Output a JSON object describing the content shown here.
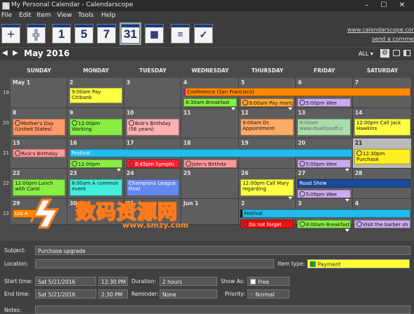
{
  "window": {
    "title": "My Personal Calendar - Calendarscope"
  },
  "menu": [
    "File",
    "Edit",
    "Item",
    "View",
    "Tools",
    "Help"
  ],
  "toolbar": {
    "buttons": [
      "",
      "",
      "1",
      "5",
      "7",
      "31",
      "",
      "",
      ""
    ],
    "site_link": "www.calendarscope.com",
    "comment_link": "send a comment"
  },
  "nav": {
    "month": "May 2016",
    "filter": "ALL"
  },
  "calendar": {
    "days": [
      "SUNDAY",
      "MONDAY",
      "TUESDAY",
      "WEDNESDAY",
      "THURSDAY",
      "FRIDAY",
      "SATURDAY"
    ],
    "weeks": [
      "19",
      "20",
      "21",
      "22",
      "23"
    ],
    "dates": [
      [
        "May 1",
        "2",
        "3",
        "4",
        "5",
        "6",
        "7"
      ],
      [
        "8",
        "9",
        "10",
        "11",
        "12",
        "13",
        "14"
      ],
      [
        "15",
        "16",
        "17",
        "18",
        "19",
        "20",
        "21"
      ],
      [
        "22",
        "23",
        "24",
        "25",
        "26",
        "27",
        "28"
      ],
      [
        "29",
        "30",
        "31",
        "Jun 1",
        "2",
        "3",
        "4"
      ]
    ],
    "events": {
      "pay_citibank": "9:00am Pay Citibank",
      "conference": "Conference (San Francisco)",
      "breakfast1": "8:30am Breakfast",
      "pay_mortgage": "9:00am Pay mortga",
      "wee1": "5:00pm Wee",
      "mothers_day": "Mother's Day (United States)",
      "working": "12:00pm Working",
      "bobs_birthday": "Bob's Birthday (56 years)",
      "dr_appt": "9:00am Dr. Appointment",
      "dualitysoft": "9:00am www.dualitysoft.c",
      "call_jack": "12:00pm Call Jack Hawkins",
      "ricks_birthday": "Rick's Birthday",
      "festival1": "Festival",
      "purchase": "12:30pm Purchase",
      "t1200": "12:00pm",
      "symphony": "6:45pm Symphi",
      "johns_birthday": "John's Birthda",
      "wee2": "5:00pm Wee",
      "lunch_carol": "12:00pm Lunch with Carol",
      "common_event": "8:00am A common event",
      "champions": "Champions League Final",
      "call_mary": "12:00pm Call Mary regarding",
      "road_show": "Road Show",
      "wee3": "5:00pm Wee",
      "los": "Los A",
      "festival2": "Festival",
      "dont_forget": "Do not forget",
      "breakfast2": "8:00am Breakfast",
      "barber": "Visit the barber sh"
    }
  },
  "details": {
    "subject_label": "Subject:",
    "subject": "Purchase upgrade",
    "location_label": "Location:",
    "location": "",
    "item_type_label": "Item type:",
    "item_type": "Payment",
    "start_label": "Start time:",
    "start_date": "Sat 5/21/2016",
    "start_time": "12:30 PM",
    "duration_label": "Duration:",
    "duration": "2 hours",
    "show_as_label": "Show As:",
    "show_as": "Free",
    "end_label": "End time:",
    "end_date": "Sat 5/21/2016",
    "end_time": "2:30 PM",
    "reminder_label": "Reminder:",
    "reminder": "None",
    "priority_label": "Priority:",
    "priority": "Normal",
    "notes_label": "Notes:"
  },
  "watermark": {
    "main": "数码资源网",
    "sub": "www.smzy.com"
  }
}
